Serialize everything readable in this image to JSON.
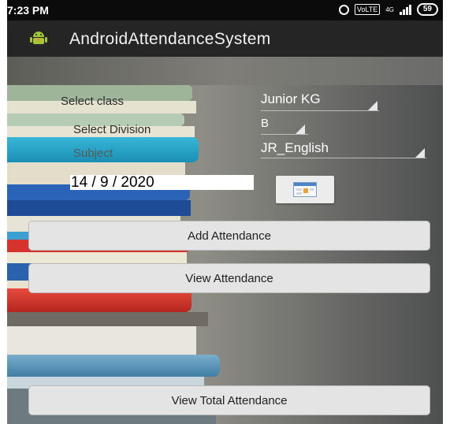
{
  "status_bar": {
    "time": "7:23 PM",
    "icons": [
      "alarm-icon",
      "volte-icon",
      "signal-icon",
      "battery-icon"
    ],
    "vo_label": "VoLTE",
    "network_label": "4G",
    "battery": "59"
  },
  "action_bar": {
    "icon": "android-icon",
    "title": "AndroidAttendanceSystem"
  },
  "form": {
    "class_label": "Select class",
    "class_value": "Junior KG",
    "division_label": "Select Division",
    "division_value": "B",
    "subject_label": "Subject",
    "subject_value": "JR_English",
    "date_value": "14 / 9 / 2020",
    "calendar_icon": "calendar-icon"
  },
  "buttons": {
    "add_attendance": "Add Attendance",
    "view_attendance": "View Attendance",
    "view_total_attendance": "View Total Attendance"
  },
  "colors": {
    "status_bar": "#0b0b0b",
    "action_bar": "#252526",
    "android_green": "#a4c639",
    "button_bg": "#e4e4e4"
  }
}
